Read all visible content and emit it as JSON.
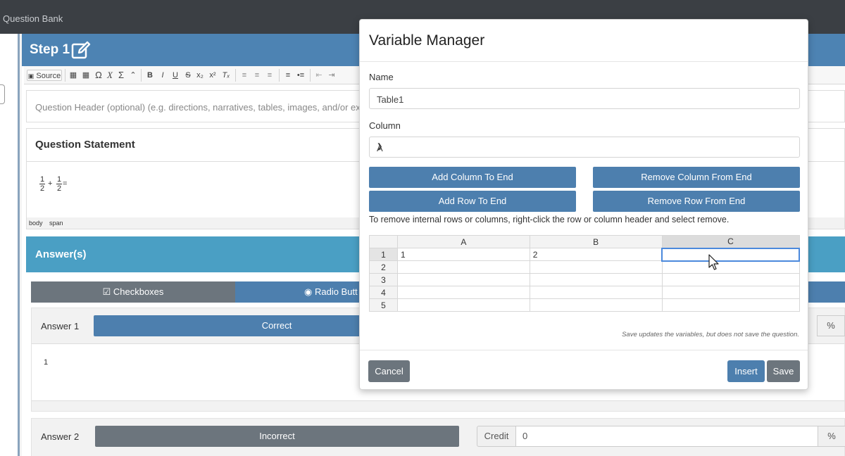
{
  "app": {
    "title": "Question Bank"
  },
  "step": {
    "label": "Step 1"
  },
  "toolbar": {
    "source_label": "Source"
  },
  "question_header": {
    "placeholder": "Question Header (optional) (e.g. directions, narratives, tables, images, and/or expr"
  },
  "question_statement": {
    "title": "Question Statement",
    "frac1_num": "1",
    "frac1_den": "2",
    "plus": "+",
    "frac2_num": "1",
    "frac2_den": "2",
    "equals": "=",
    "path": [
      "body",
      "span"
    ]
  },
  "answers_section": {
    "title": "Answer(s)"
  },
  "answer_types": {
    "checkboxes": "Checkboxes",
    "radio": "Radio Butt"
  },
  "answers": [
    {
      "label": "Answer 1",
      "status": "Correct",
      "body": "1",
      "percent": "%"
    },
    {
      "label": "Answer 2",
      "status": "Incorrect",
      "credit_label": "Credit",
      "credit_value": "0",
      "percent": "%"
    }
  ],
  "modal": {
    "title": "Variable Manager",
    "name_label": "Name",
    "name_value": "Table1",
    "column_label": "Column",
    "column_value": "A",
    "add_column": "Add Column To End",
    "remove_column": "Remove Column From End",
    "add_row": "Add Row To End",
    "remove_row": "Remove Row From End",
    "hint": "To remove internal rows or columns, right-click the row or column header and select remove.",
    "grid": {
      "columns": [
        "A",
        "B",
        "C"
      ],
      "rows": [
        {
          "n": "1",
          "cells": [
            "1",
            "2",
            ""
          ]
        },
        {
          "n": "2",
          "cells": [
            "",
            "",
            ""
          ]
        },
        {
          "n": "3",
          "cells": [
            "",
            "",
            ""
          ]
        },
        {
          "n": "4",
          "cells": [
            "",
            "",
            ""
          ]
        },
        {
          "n": "5",
          "cells": [
            "",
            "",
            ""
          ]
        }
      ]
    },
    "save_note": "Save updates the variables, but does not save the question.",
    "cancel": "Cancel",
    "insert": "Insert",
    "save": "Save"
  },
  "colors": {
    "topbar": "#3b3f44",
    "step_header": "#4d83b3",
    "answers_bar": "#4a9fc4",
    "primary_button": "#4d7fae",
    "secondary_button": "#6c757d"
  }
}
